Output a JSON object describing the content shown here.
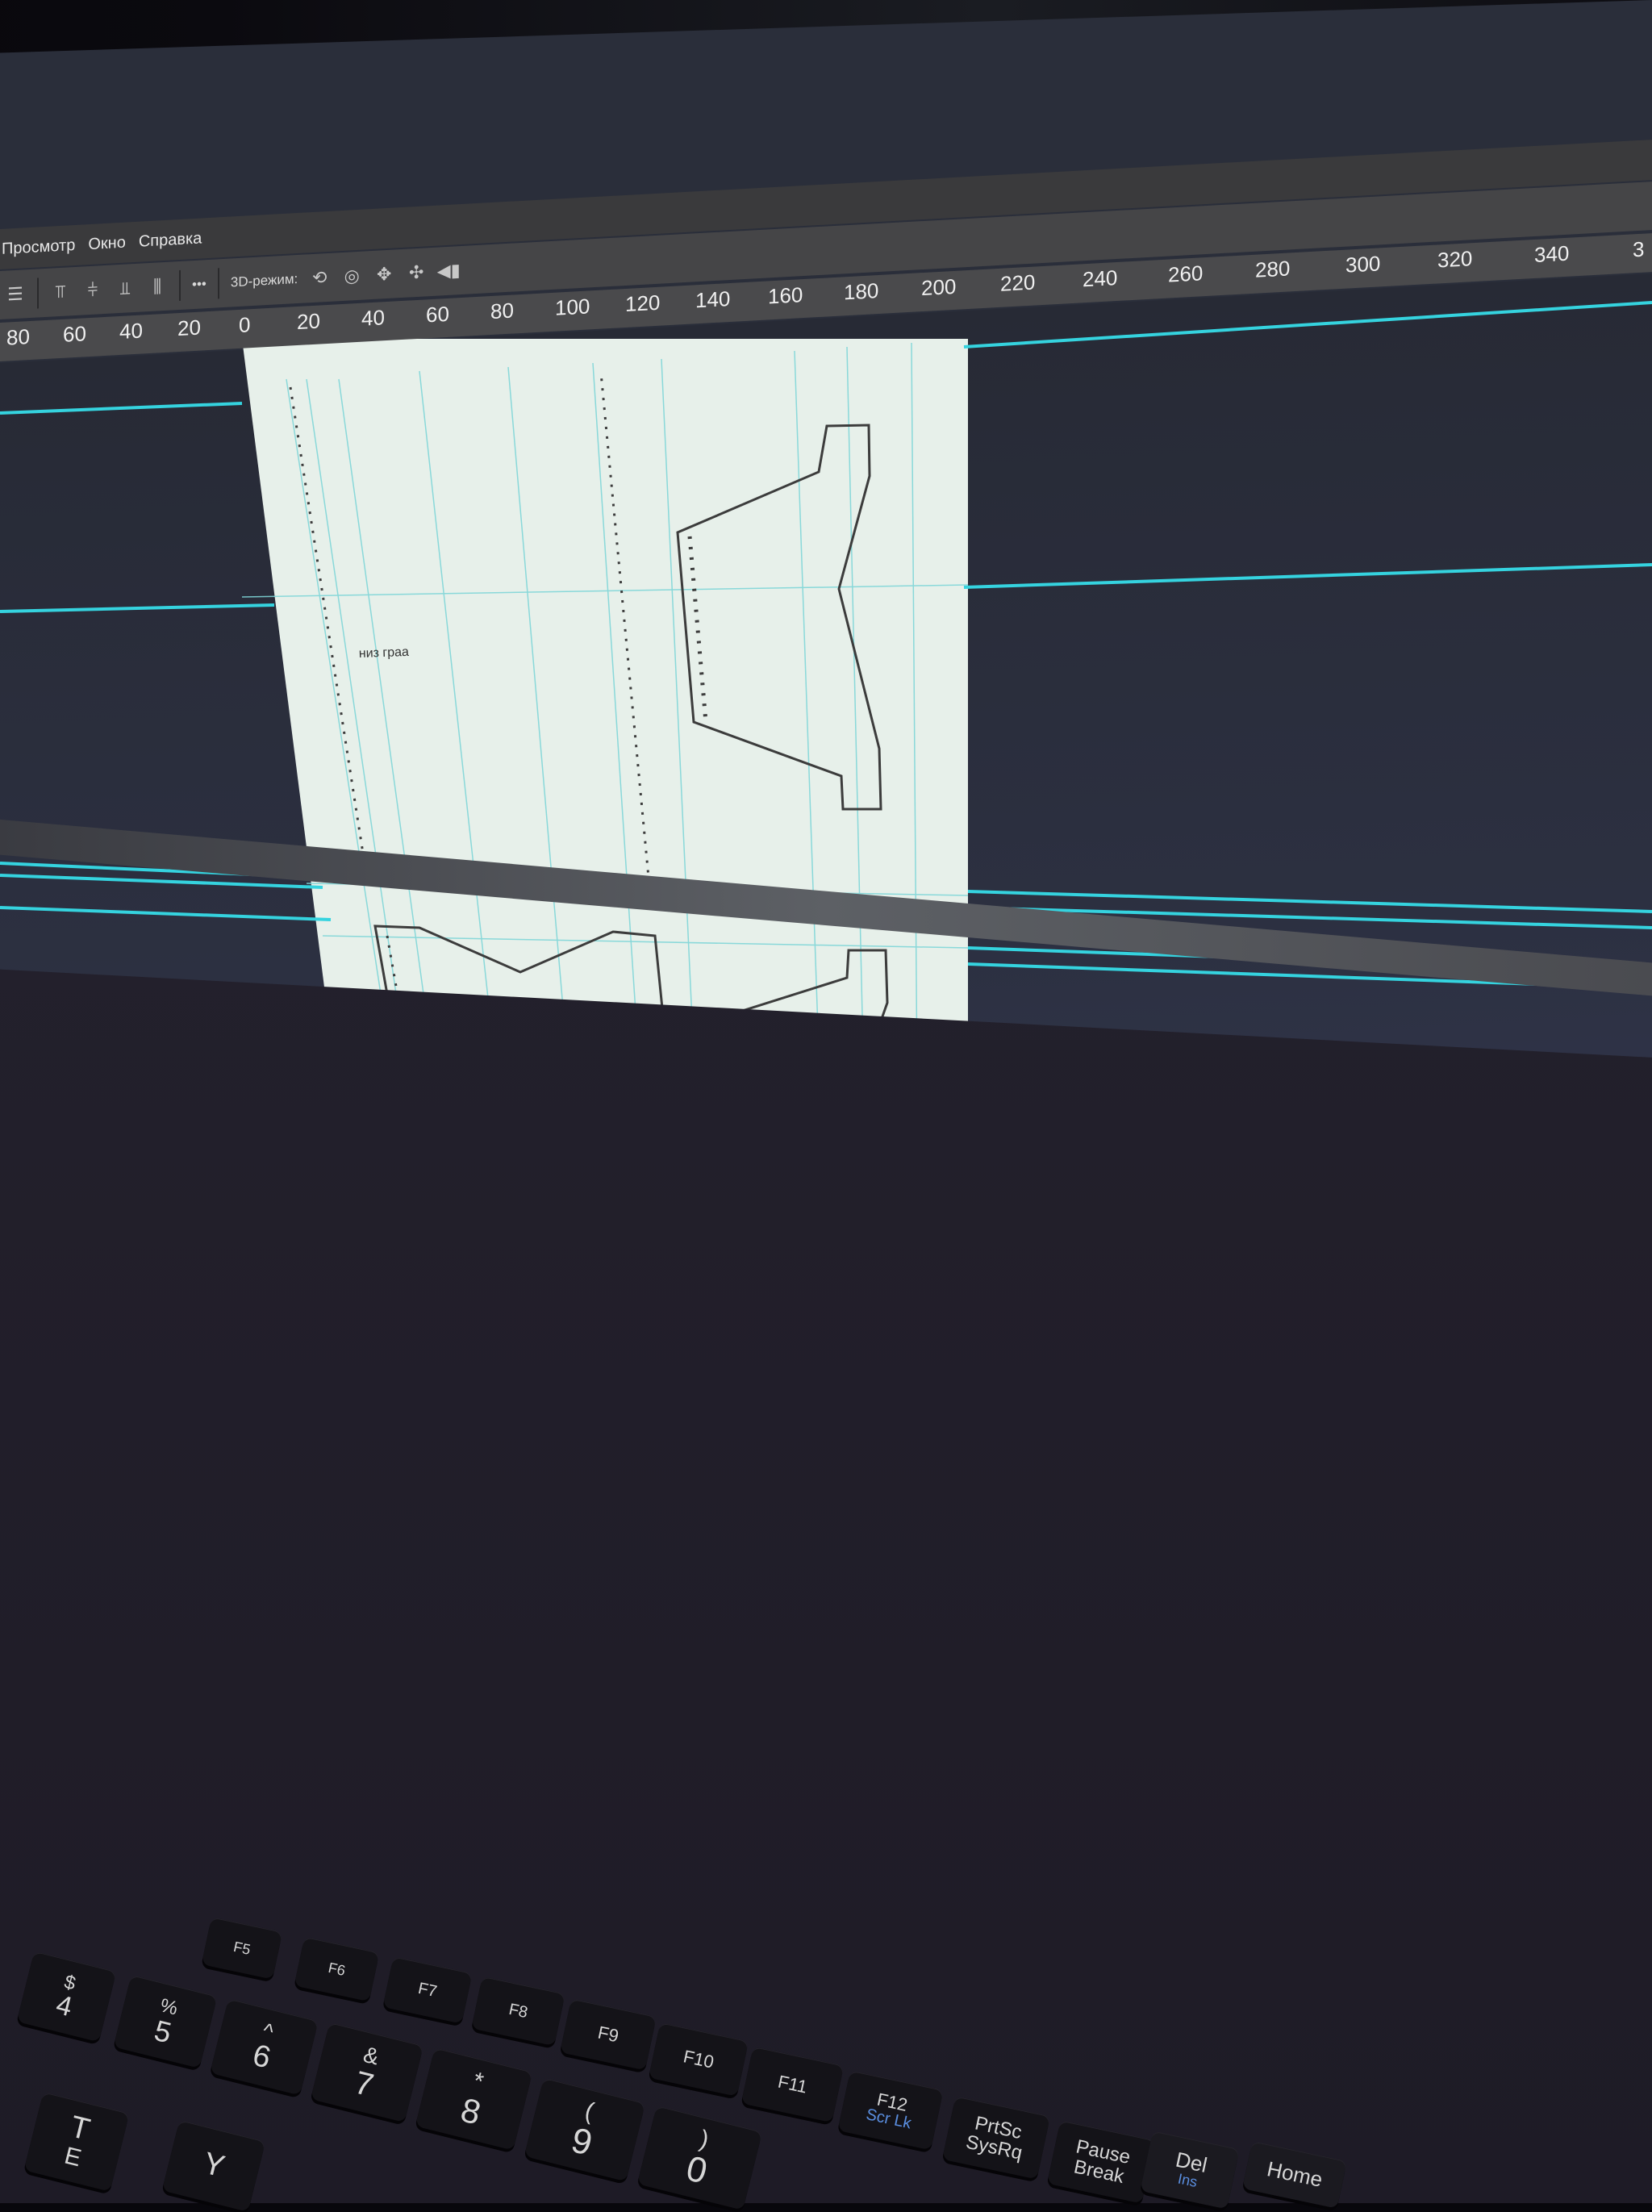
{
  "menu": {
    "items": [
      "Просмотр",
      "Окно",
      "Справка"
    ]
  },
  "options_bar": {
    "more_label": "•••",
    "mode_label": "3D-режим:"
  },
  "ruler": {
    "top_ticks": [
      "80",
      "60",
      "40",
      "20",
      "0",
      "20",
      "40",
      "60",
      "80",
      "100",
      "120",
      "140",
      "160",
      "180",
      "200",
      "220",
      "240",
      "260",
      "280",
      "300",
      "320",
      "340",
      "3"
    ]
  },
  "document": {
    "label_text": "низ граа"
  },
  "keyboard": {
    "keys": [
      {
        "label": "F5"
      },
      {
        "label": "F6"
      },
      {
        "label": "F7"
      },
      {
        "label": "F8"
      },
      {
        "label": "F9"
      },
      {
        "label": "F10"
      },
      {
        "label": "F11"
      },
      {
        "label": "F12",
        "sub": "Scr Lk"
      },
      {
        "label": "PrtSc",
        "sub": "SysRq"
      },
      {
        "label": "Pause",
        "sub": "Break"
      },
      {
        "label": "Del",
        "sub": "Ins"
      },
      {
        "label": "Home"
      }
    ],
    "number_row": [
      "$",
      "%",
      "^",
      "&",
      "*",
      "(",
      ")"
    ],
    "digits": [
      "4",
      "5",
      "6",
      "7",
      "8",
      "9",
      "0"
    ],
    "letters": [
      "T",
      "E",
      "Y"
    ]
  },
  "colors": {
    "guide": "#35d3df",
    "canvas_bg": "#2a2e3a",
    "document": "#e7f0ea",
    "ruler_bg": "#4a4a4c"
  }
}
